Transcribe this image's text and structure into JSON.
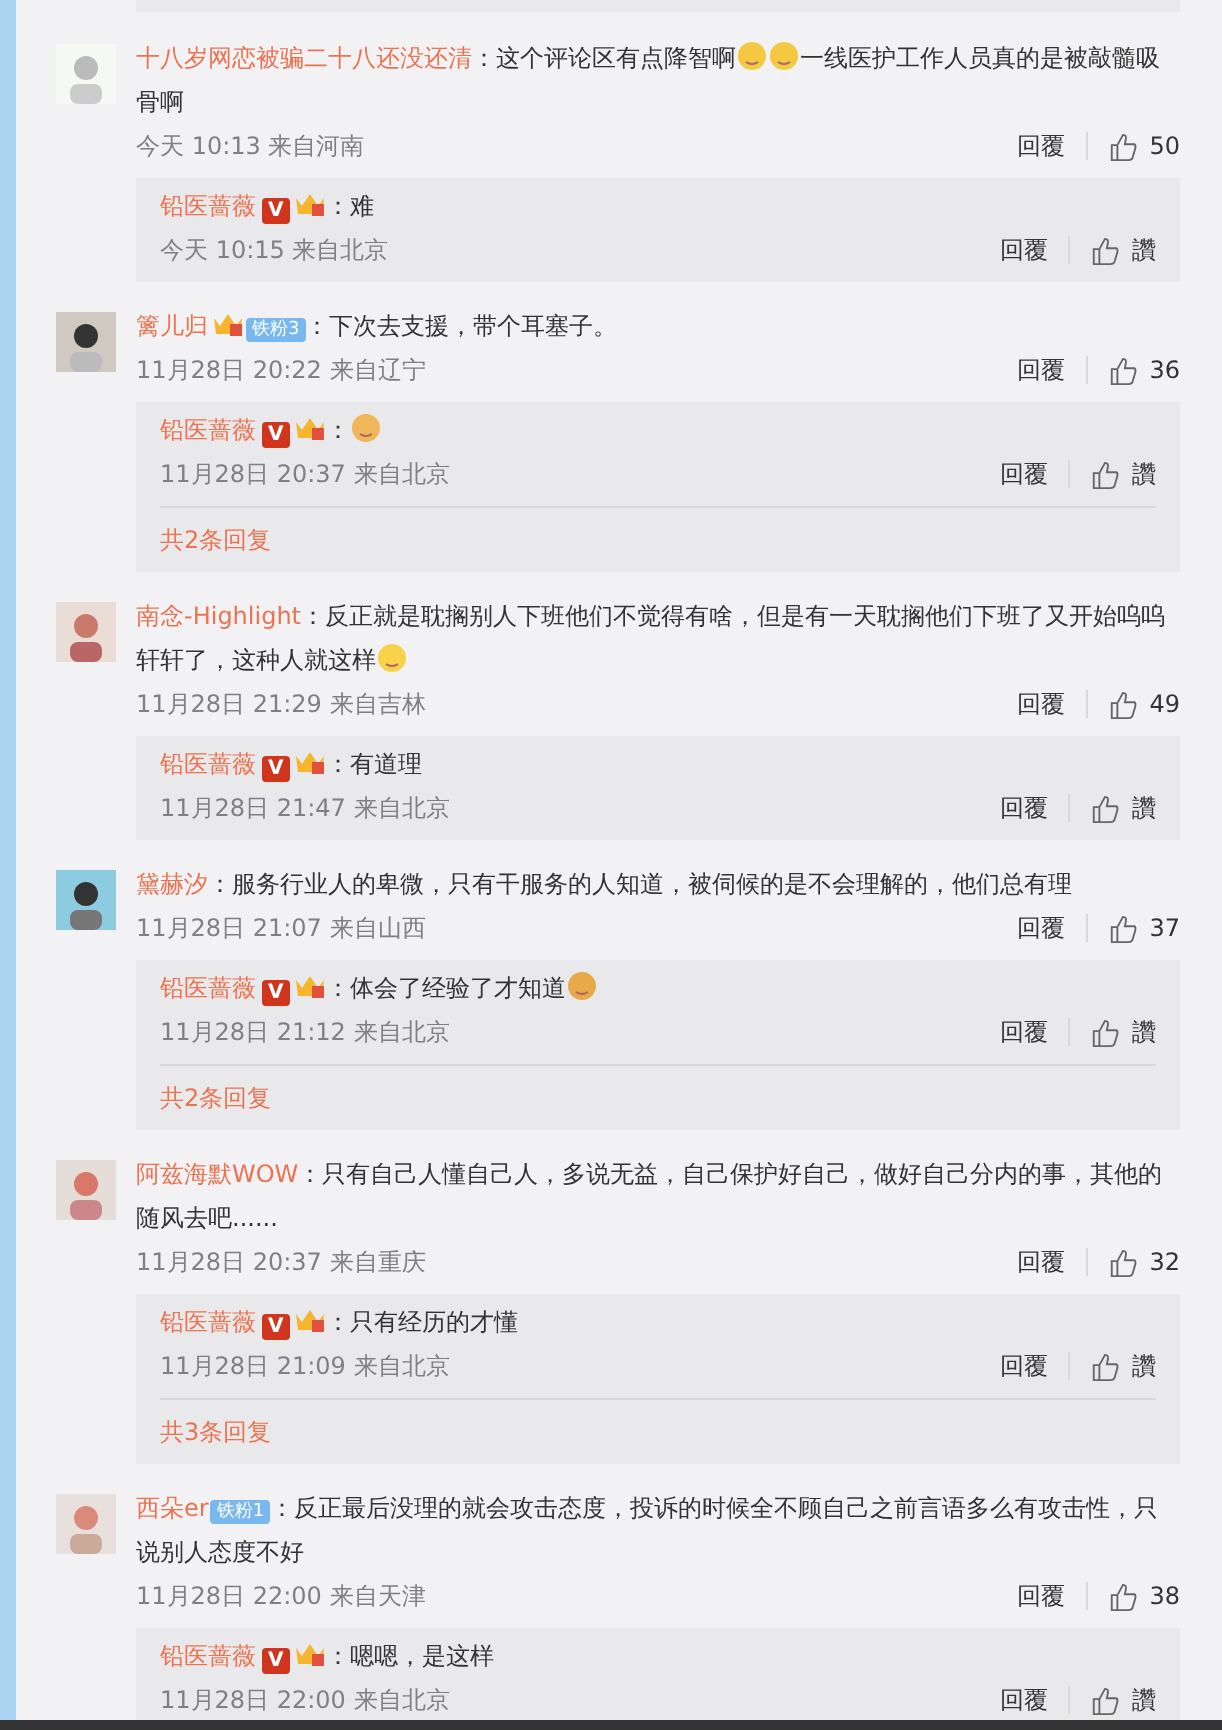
{
  "comments": [
    {
      "user": "十八岁网恋被骗二十八还没还清",
      "parts": [
        {
          "kind": "text",
          "text": "：这个评论区有点降智啊"
        },
        {
          "kind": "cry"
        },
        {
          "kind": "cry"
        },
        {
          "kind": "text",
          "text": "一线医护工作人员真的是被敲髓吸骨啊"
        }
      ],
      "time": "今天 10:13 来自河南",
      "reply_label": "回覆",
      "likes": "50",
      "replies": [
        {
          "user": "铅医蔷薇",
          "badges": [
            {
              "kind": "v",
              "text": "V"
            },
            {
              "kind": "crown"
            }
          ],
          "parts": [
            {
              "kind": "text",
              "text": "：难"
            }
          ],
          "time": "今天 10:15 来自北京",
          "reply_label": "回覆",
          "likes": "讚"
        }
      ]
    },
    {
      "user": "篱儿归",
      "badges": [
        {
          "kind": "crown"
        },
        {
          "kind": "fan",
          "text": "铁粉3"
        }
      ],
      "parts": [
        {
          "kind": "text",
          "text": "：下次去支援，带个耳塞子。"
        }
      ],
      "time": "11月28日 20:22 来自辽宁",
      "reply_label": "回覆",
      "likes": "36",
      "replies": [
        {
          "user": "铅医蔷薇",
          "badges": [
            {
              "kind": "v",
              "text": "V"
            },
            {
              "kind": "crown"
            }
          ],
          "parts": [
            {
              "kind": "text",
              "text": "："
            },
            {
              "kind": "thumbs"
            }
          ],
          "time": "11月28日 20:37 来自北京",
          "reply_label": "回覆",
          "likes": "讚"
        }
      ],
      "more": "共2条回复"
    },
    {
      "user": "南念-Highlight",
      "parts": [
        {
          "kind": "text",
          "text": "：反正就是耽搁别人下班他们不觉得有啥，但是有一天耽搁他们下班了又开始呜呜轩轩了，这种人就这样"
        },
        {
          "kind": "thinking"
        }
      ],
      "time": "11月28日 21:29 来自吉林",
      "reply_label": "回覆",
      "likes": "49",
      "replies": [
        {
          "user": "铅医蔷薇",
          "badges": [
            {
              "kind": "v",
              "text": "V"
            },
            {
              "kind": "crown"
            }
          ],
          "parts": [
            {
              "kind": "text",
              "text": "：有道理"
            }
          ],
          "time": "11月28日 21:47 来自北京",
          "reply_label": "回覆",
          "likes": "讚"
        }
      ]
    },
    {
      "user": "黛赫汐",
      "parts": [
        {
          "kind": "text",
          "text": "：服务行业人的卑微，只有干服务的人知道，被伺候的是不会理解的，他们总有理"
        }
      ],
      "time": "11月28日 21:07 来自山西",
      "reply_label": "回覆",
      "likes": "37",
      "replies": [
        {
          "user": "铅医蔷薇",
          "badges": [
            {
              "kind": "v",
              "text": "V"
            },
            {
              "kind": "crown"
            }
          ],
          "parts": [
            {
              "kind": "text",
              "text": "：体会了经验了才知道"
            },
            {
              "kind": "pray"
            }
          ],
          "time": "11月28日 21:12 来自北京",
          "reply_label": "回覆",
          "likes": "讚"
        }
      ],
      "more": "共2条回复"
    },
    {
      "user": "阿兹海默WOW",
      "parts": [
        {
          "kind": "text",
          "text": "：只有自己人懂自己人，多说无益，自己保护好自己，做好自己分内的事，其他的随风去吧......"
        }
      ],
      "time": "11月28日 20:37 来自重庆",
      "reply_label": "回覆",
      "likes": "32",
      "replies": [
        {
          "user": "铅医蔷薇",
          "badges": [
            {
              "kind": "v",
              "text": "V"
            },
            {
              "kind": "crown"
            }
          ],
          "parts": [
            {
              "kind": "text",
              "text": "：只有经历的才懂"
            }
          ],
          "time": "11月28日 21:09 来自北京",
          "reply_label": "回覆",
          "likes": "讚"
        }
      ],
      "more": "共3条回复"
    },
    {
      "user": "西朵er",
      "badges": [
        {
          "kind": "fan",
          "text": "铁粉1"
        }
      ],
      "parts": [
        {
          "kind": "text",
          "text": "：反正最后没理的就会攻击态度，投诉的时候全不顾自己之前言语多么有攻击性，只说别人态度不好"
        }
      ],
      "time": "11月28日 22:00 来自天津",
      "reply_label": "回覆",
      "likes": "38",
      "replies": [
        {
          "user": "铅医蔷薇",
          "badges": [
            {
              "kind": "v",
              "text": "V"
            },
            {
              "kind": "crown"
            }
          ],
          "parts": [
            {
              "kind": "text",
              "text": "：嗯嗯，是这样"
            }
          ],
          "time": "11月28日 22:00 来自北京",
          "reply_label": "回覆",
          "likes": "讚"
        }
      ]
    }
  ]
}
